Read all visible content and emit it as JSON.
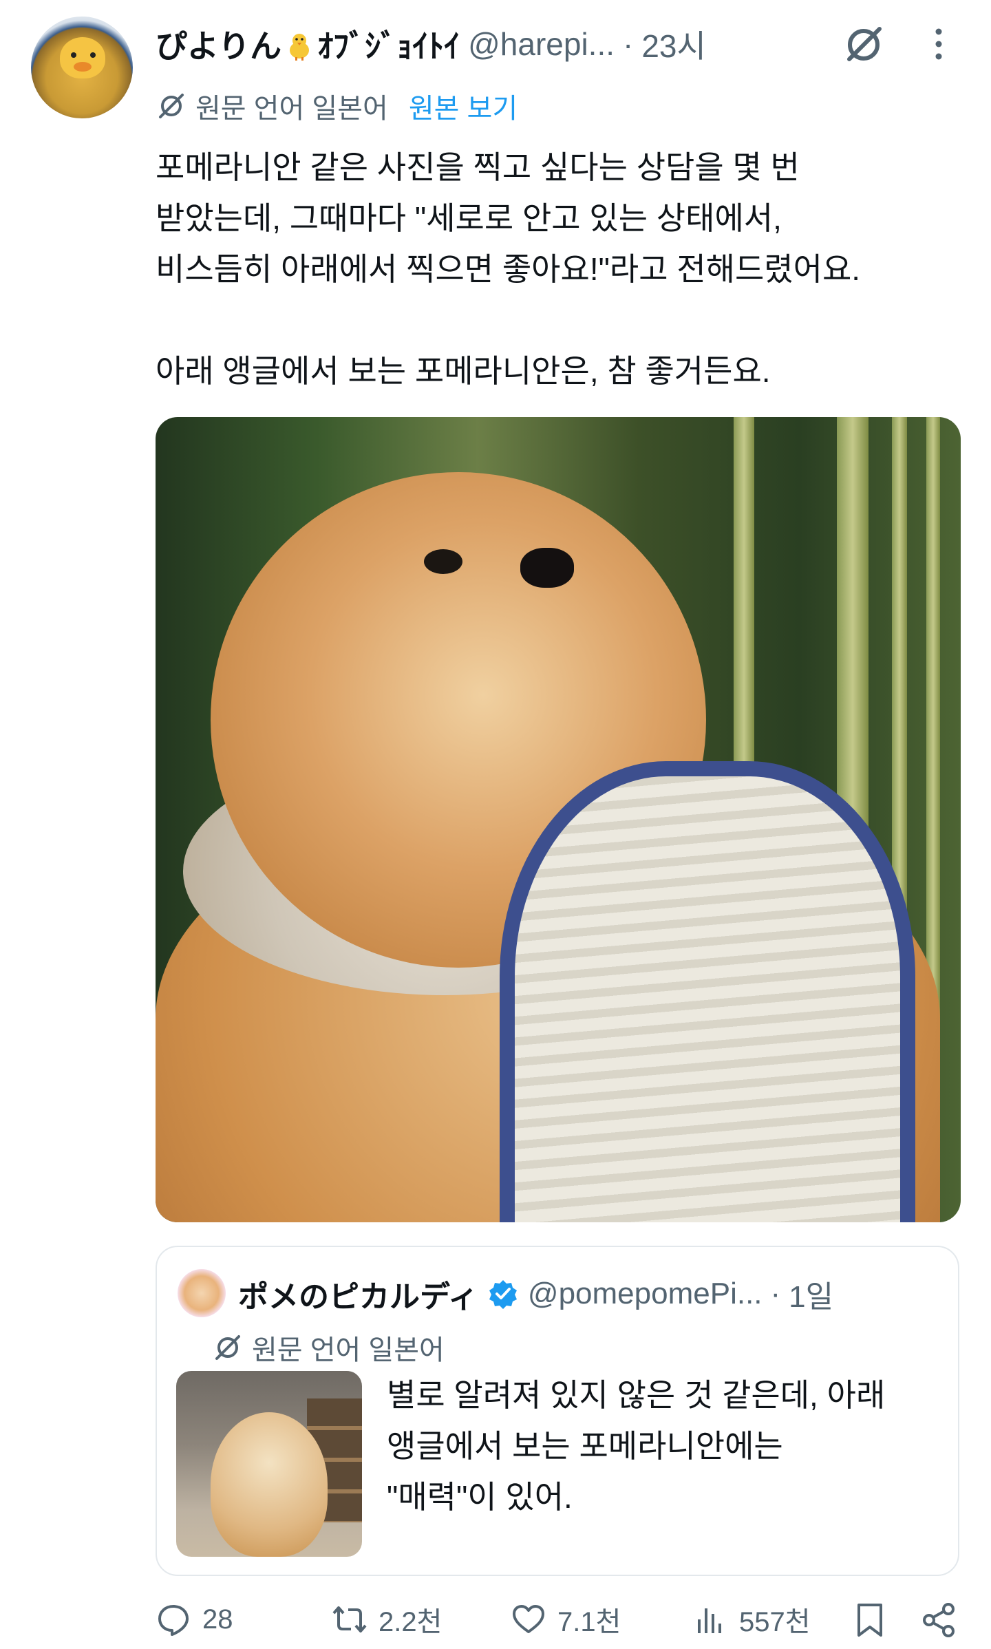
{
  "tweet": {
    "display_name_before": "ぴよりん",
    "display_name_after": "ｵﾌﾞｼﾞｮｲﾄｲ",
    "handle": "@harepi...",
    "dot": "·",
    "time": "23시",
    "translate_label": "원문 언어 일본어",
    "translate_link": "원본 보기",
    "text_lines": [
      "포메라니안 같은 사진을 찍고 싶다는 상담을 몇 번",
      "받았는데, 그때마다 \"세로로 안고 있는 상태에서,",
      "비스듬히 아래에서 찍으면 좋아요!\"라고 전해드렸어요.",
      "아래 앵글에서 보는 포메라니안은, 참 좋거든요."
    ]
  },
  "quote": {
    "display_name": "ポメのピカルディ",
    "handle": "@pomepomePi...",
    "dot": "·",
    "time": "1일",
    "translate_label": "원문 언어 일본어",
    "text_lines": [
      "별로 알려져 있지 않은 것 같은데, 아래",
      "앵글에서 보는 포메라니안에는",
      "\"매력\"이 있어."
    ]
  },
  "actions": {
    "replies": "28",
    "retweets": "2.2천",
    "likes": "7.1천",
    "views": "557천"
  },
  "colors": {
    "text_primary": "#0f1419",
    "text_secondary": "#536471",
    "link": "#1d9bf0",
    "verified": "#1d9bf0",
    "border": "#e3e8ec"
  }
}
